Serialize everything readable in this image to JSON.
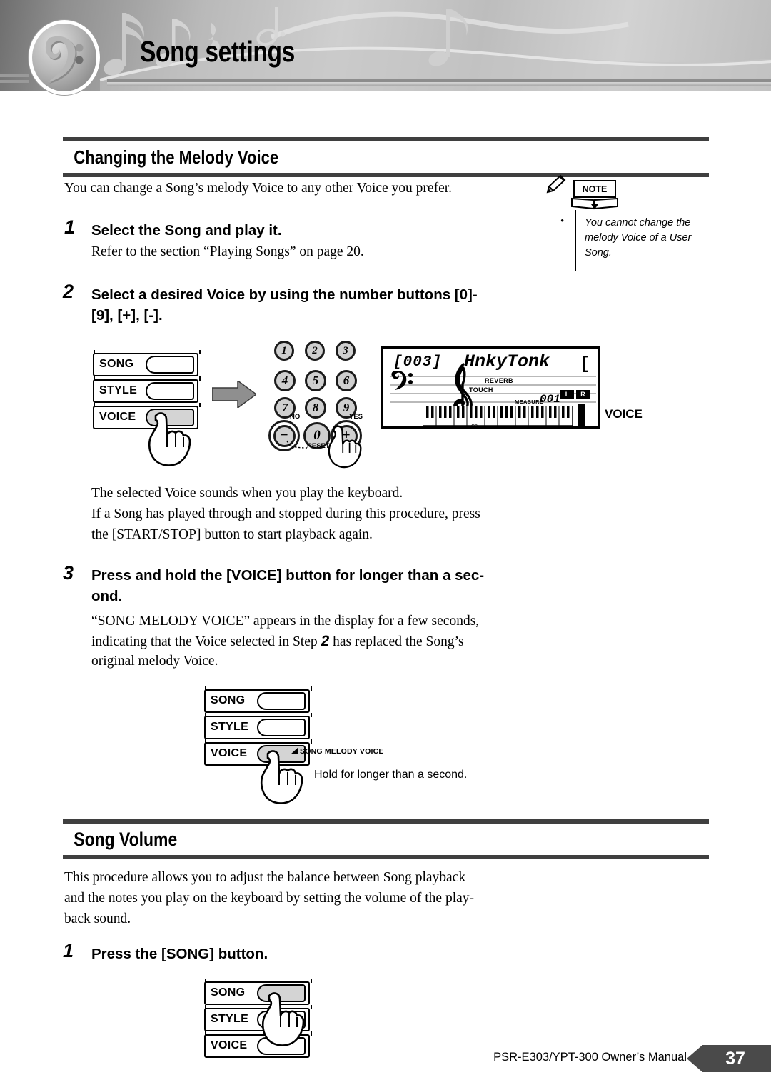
{
  "header": {
    "title": "Song settings",
    "logo_icon": "bass-clef-icon"
  },
  "sections": [
    {
      "id": "melody-voice",
      "title": "Changing the Melody Voice",
      "intro": "You can change a Song’s melody Voice to any other Voice you prefer.",
      "steps": [
        {
          "num": "1",
          "title": "Select the Song and play it.",
          "body": "Refer to the section “Playing Songs” on page 20."
        },
        {
          "num": "2",
          "title_line1": "Select a desired Voice by using the number buttons [0]-",
          "title_line2": "[9], [+], [-].",
          "body_line1": "The selected Voice sounds when you play the keyboard.",
          "body_line2": "If a Song has played through and stopped during this procedure, press",
          "body_line3": "the [START/STOP] button to start playback again."
        },
        {
          "num": "3",
          "title_line1": "Press and hold the [VOICE] button for longer than a sec-",
          "title_line2": "ond.",
          "body_line1_a": "“SONG MELODY VOICE” appears in the display for a few seconds,",
          "body_line2_a": "indicating that the Voice selected in Step ",
          "body_line2_num": "2",
          "body_line2_b": " has replaced the Song’s",
          "body_line3": "original melody Voice."
        }
      ]
    },
    {
      "id": "song-volume",
      "title": "Song Volume",
      "intro_line1": "This procedure allows you to adjust the balance between Song playback",
      "intro_line2": "and the notes you play on the keyboard by setting the volume of the play-",
      "intro_line3": "back sound.",
      "steps": [
        {
          "num": "1",
          "title": "Press the [SONG] button."
        }
      ]
    }
  ],
  "note": {
    "label": "NOTE",
    "bullet": "•",
    "text": "You cannot change the melody Voice of a User Song."
  },
  "panel_step2": {
    "buttons": [
      {
        "label": "SONG",
        "pressed": false
      },
      {
        "label": "STYLE",
        "pressed": false
      },
      {
        "label": "VOICE",
        "pressed": true
      }
    ]
  },
  "panel_step3": {
    "buttons": [
      {
        "label": "SONG",
        "pressed": false
      },
      {
        "label": "STYLE",
        "pressed": false
      },
      {
        "label": "VOICE",
        "pressed": true
      }
    ],
    "callout": "SONG MELODY VOICE",
    "caption": "Hold for longer than a second."
  },
  "panel_volume": {
    "buttons": [
      {
        "label": "SONG",
        "pressed": true
      },
      {
        "label": "STYLE",
        "pressed": false
      },
      {
        "label": "VOICE",
        "pressed": false
      }
    ]
  },
  "numpad": {
    "circled_markers": [
      "1",
      "2",
      "3"
    ],
    "keys": [
      "1",
      "2",
      "3",
      "4",
      "5",
      "6",
      "7",
      "8",
      "9"
    ],
    "minus": "−",
    "zero": "0",
    "plus": "+",
    "label_no": "NO",
    "label_yes": "YES",
    "label_reset": "RESET"
  },
  "lcd": {
    "voice_number": "[003]",
    "voice_name": "HnkyTonk",
    "right_bracket": "[",
    "reverb": "REVERB",
    "touch": "TOUCH",
    "measure_label": "MEASURE",
    "measure_value": "001",
    "left_indicator": "L",
    "right_indicator": "R",
    "key_marker": "C3",
    "side_label": "VOICE"
  },
  "footer": {
    "manual": "PSR-E303/YPT-300  Owner’s Manual",
    "page": "37"
  },
  "colors": {
    "rule": "#3f3f3f",
    "page_tag_bg": "#4a4a4a",
    "button_pressed": "#d4d4d4",
    "numkey_fill": "#cfcfcf"
  }
}
